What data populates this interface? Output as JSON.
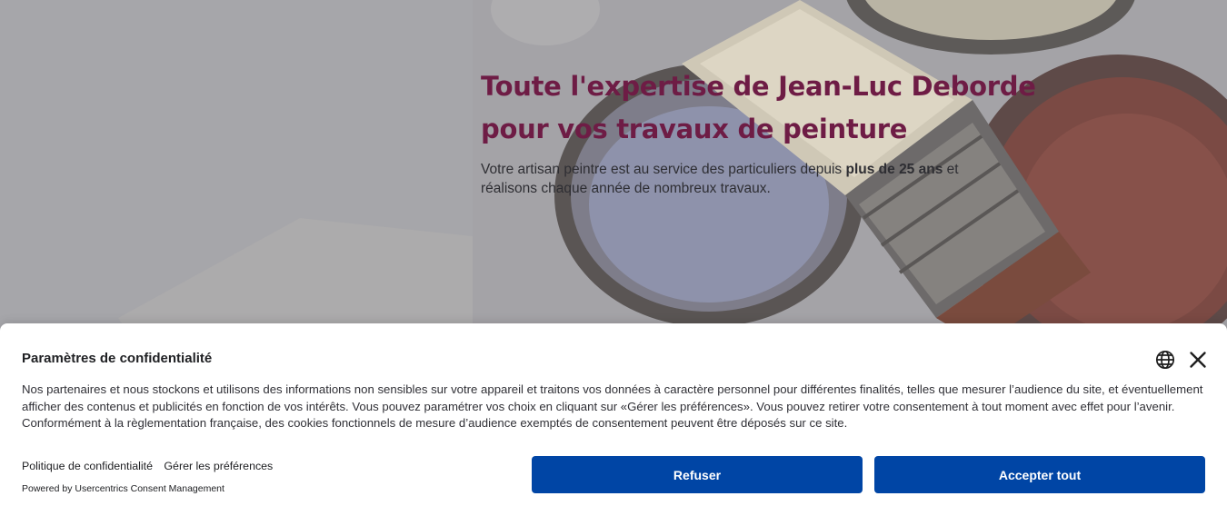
{
  "hero": {
    "title_line1": "Toute l'expertise de Jean-Luc Deborde",
    "title_line2": "pour vos travaux de peinture",
    "subtitle_pre": "Votre artisan peintre est au service des particuliers depuis ",
    "subtitle_bold": "plus de 25 ans",
    "subtitle_post": " et réalisons chaque année de nombreux travaux.",
    "title_color": "#6e1c45"
  },
  "consent": {
    "title": "Paramètres de confidentialité",
    "description": "Nos partenaires et nous stockons et utilisons des informations non sensibles sur votre appareil et traitons vos données à caractère personnel pour différentes finalités, telles que mesurer l’audience du site, et éventuellement afficher des contenus et publicités en fonction de vos intérêts. Vous pouvez paramétrer vos choix en cliquant sur «Gérer les préférences». Vous pouvez retirer votre consentement à tout moment avec effet pour l’avenir. Conformément à la règlementation française, des cookies fonctionnels de mesure d’audience exemptés de consentement peuvent être déposés sur ce site.",
    "privacy_link": "Politique de confidentialité",
    "preferences_link": "Gérer les préférences",
    "powered_by": "Powered by Usercentrics Consent Management",
    "refuse_label": "Refuser",
    "accept_label": "Accepter tout",
    "button_color": "#0045a5",
    "language_icon": "globe-icon",
    "close_icon": "close-icon"
  }
}
